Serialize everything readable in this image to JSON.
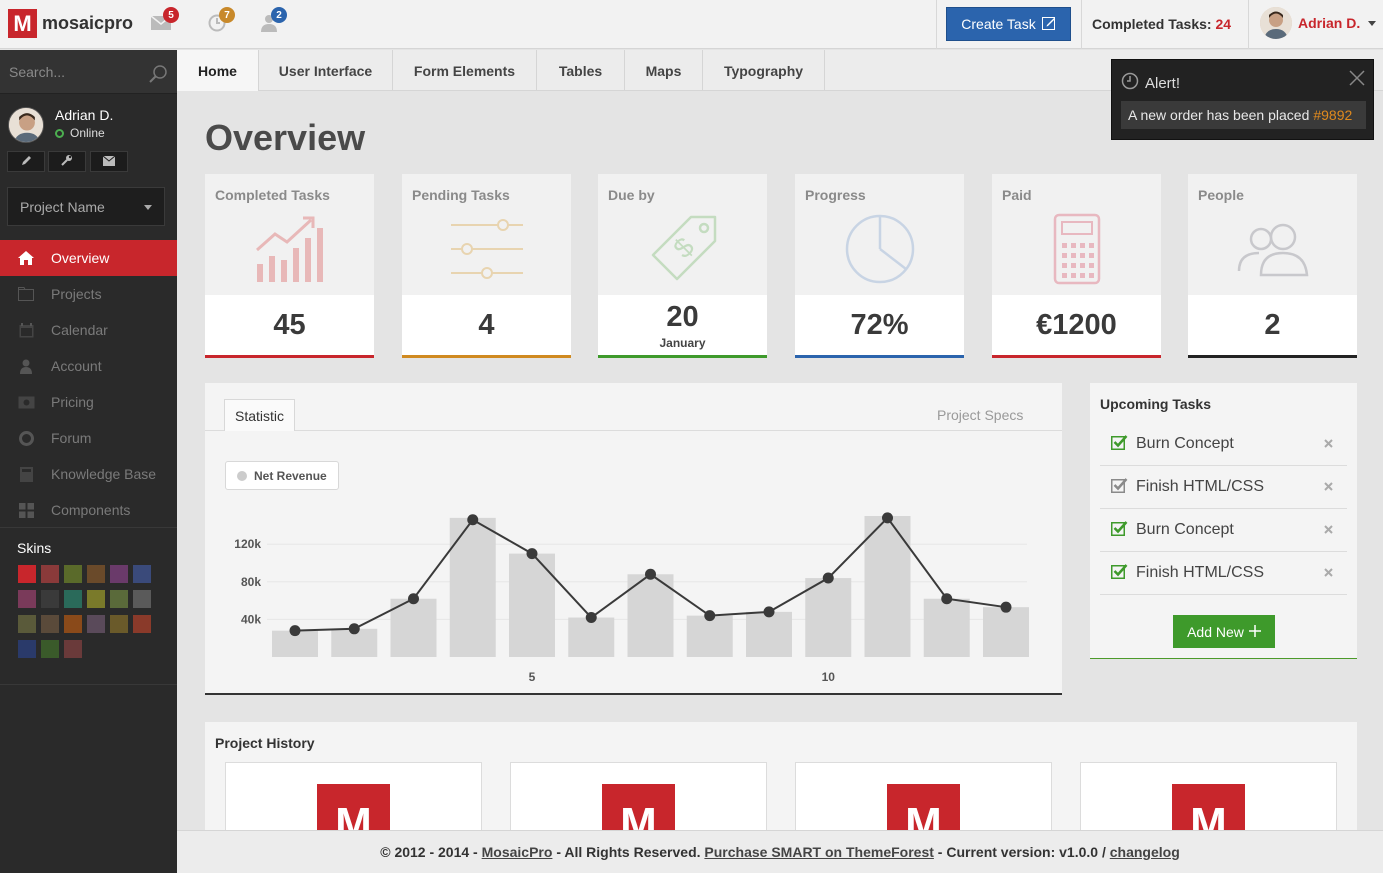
{
  "app": {
    "logo_letter": "M",
    "logo_text": "mosaicpro"
  },
  "topbar": {
    "messages_count": "5",
    "clock_count": "7",
    "users_count": "2",
    "create_task_label": "Create Task",
    "completed_label": "Completed Tasks:",
    "completed_count": "24",
    "user_name": "Adrian D."
  },
  "sidebar": {
    "search_placeholder": "Search...",
    "profile_name": "Adrian D.",
    "profile_status": "Online",
    "project_select": "Project Name",
    "nav": [
      {
        "label": "Overview",
        "icon": "home-icon"
      },
      {
        "label": "Projects",
        "icon": "folder-icon"
      },
      {
        "label": "Calendar",
        "icon": "calendar-icon"
      },
      {
        "label": "Account",
        "icon": "user-icon"
      },
      {
        "label": "Pricing",
        "icon": "money-icon"
      },
      {
        "label": "Forum",
        "icon": "lifebuoy-icon"
      },
      {
        "label": "Knowledge Base",
        "icon": "book-icon"
      },
      {
        "label": "Components",
        "icon": "grid-icon"
      }
    ],
    "skins_title": "Skins",
    "skins": [
      "#c8262c",
      "#8a3a3a",
      "#5a6a2a",
      "#6a4a2a",
      "#6a3a6a",
      "#3a4a7a",
      "#7a3a5a",
      "#3a3a3a",
      "#2a6a5a",
      "#7a7a2a",
      "#5a6a3a",
      "#5a5a5a",
      "#5a5a3a",
      "#5a4a3a",
      "#8a4a1a",
      "#5a4a5a",
      "#6a5a2a",
      "#8a3a2a",
      "#2a3a6a",
      "#3a5a2a",
      "#6a3a3a"
    ]
  },
  "tabs": [
    "Home",
    "User Interface",
    "Form Elements",
    "Tables",
    "Maps",
    "Typography"
  ],
  "alert": {
    "title": "Alert!",
    "message": "A new order has been placed",
    "order": "#9892"
  },
  "main": {
    "title": "Overview",
    "stats": [
      {
        "label": "Completed Tasks",
        "value": "45",
        "sub": "",
        "color": "#c8262c",
        "icon": "chart-up-icon"
      },
      {
        "label": "Pending Tasks",
        "value": "4",
        "sub": "",
        "color": "#d08a20",
        "icon": "sliders-icon"
      },
      {
        "label": "Due by",
        "value": "20",
        "sub": "January",
        "color": "#3e9a2b",
        "icon": "price-tag-icon"
      },
      {
        "label": "Progress",
        "value": "72%",
        "sub": "",
        "color": "#2b64ad",
        "icon": "pie-chart-icon"
      },
      {
        "label": "Paid",
        "value": "€1200",
        "sub": "",
        "color": "#c8262c",
        "icon": "calculator-icon"
      },
      {
        "label": "People",
        "value": "2",
        "sub": "",
        "color": "#222222",
        "icon": "people-icon"
      }
    ]
  },
  "statistic": {
    "tab_active": "Statistic",
    "tab_other": "Project Specs",
    "legend_label": "Net Revenue"
  },
  "chart_data": {
    "type": "bar",
    "x": [
      1,
      2,
      3,
      4,
      5,
      6,
      7,
      8,
      9,
      10,
      11,
      12,
      13
    ],
    "x_ticks": [
      5,
      10
    ],
    "y_ticks": [
      40000,
      80000,
      120000
    ],
    "y_tick_labels": [
      "40k",
      "80k",
      "120k"
    ],
    "ylim": [
      0,
      150000
    ],
    "series": [
      {
        "name": "Net Revenue",
        "kind": "bar",
        "values": [
          28000,
          30000,
          62000,
          148000,
          110000,
          42000,
          88000,
          44000,
          48000,
          84000,
          150000,
          62000,
          53000
        ]
      },
      {
        "kind": "line",
        "values": [
          28000,
          30000,
          62000,
          146000,
          110000,
          42000,
          88000,
          44000,
          48000,
          84000,
          148000,
          62000,
          53000
        ]
      }
    ],
    "grid": true
  },
  "tasks": {
    "title": "Upcoming Tasks",
    "items": [
      {
        "label": "Burn Concept",
        "done": true
      },
      {
        "label": "Finish HTML/CSS",
        "done": false
      },
      {
        "label": "Burn Concept",
        "done": true
      },
      {
        "label": "Finish HTML/CSS",
        "done": true
      }
    ],
    "add_label": "Add New"
  },
  "history": {
    "title": "Project History",
    "card_letter": "M"
  },
  "footer": {
    "copy": "© 2012 - 2014 -",
    "brand": "MosaicPro",
    "rights": "- All Rights Reserved.",
    "purchase": "Purchase SMART on ThemeForest",
    "version": "- Current version: v1.0.0 /",
    "changelog": "changelog"
  },
  "colors": {
    "accent": "#c8262c",
    "blue": "#2b64ad",
    "green": "#3e9a2b",
    "orange": "#d08a20"
  }
}
